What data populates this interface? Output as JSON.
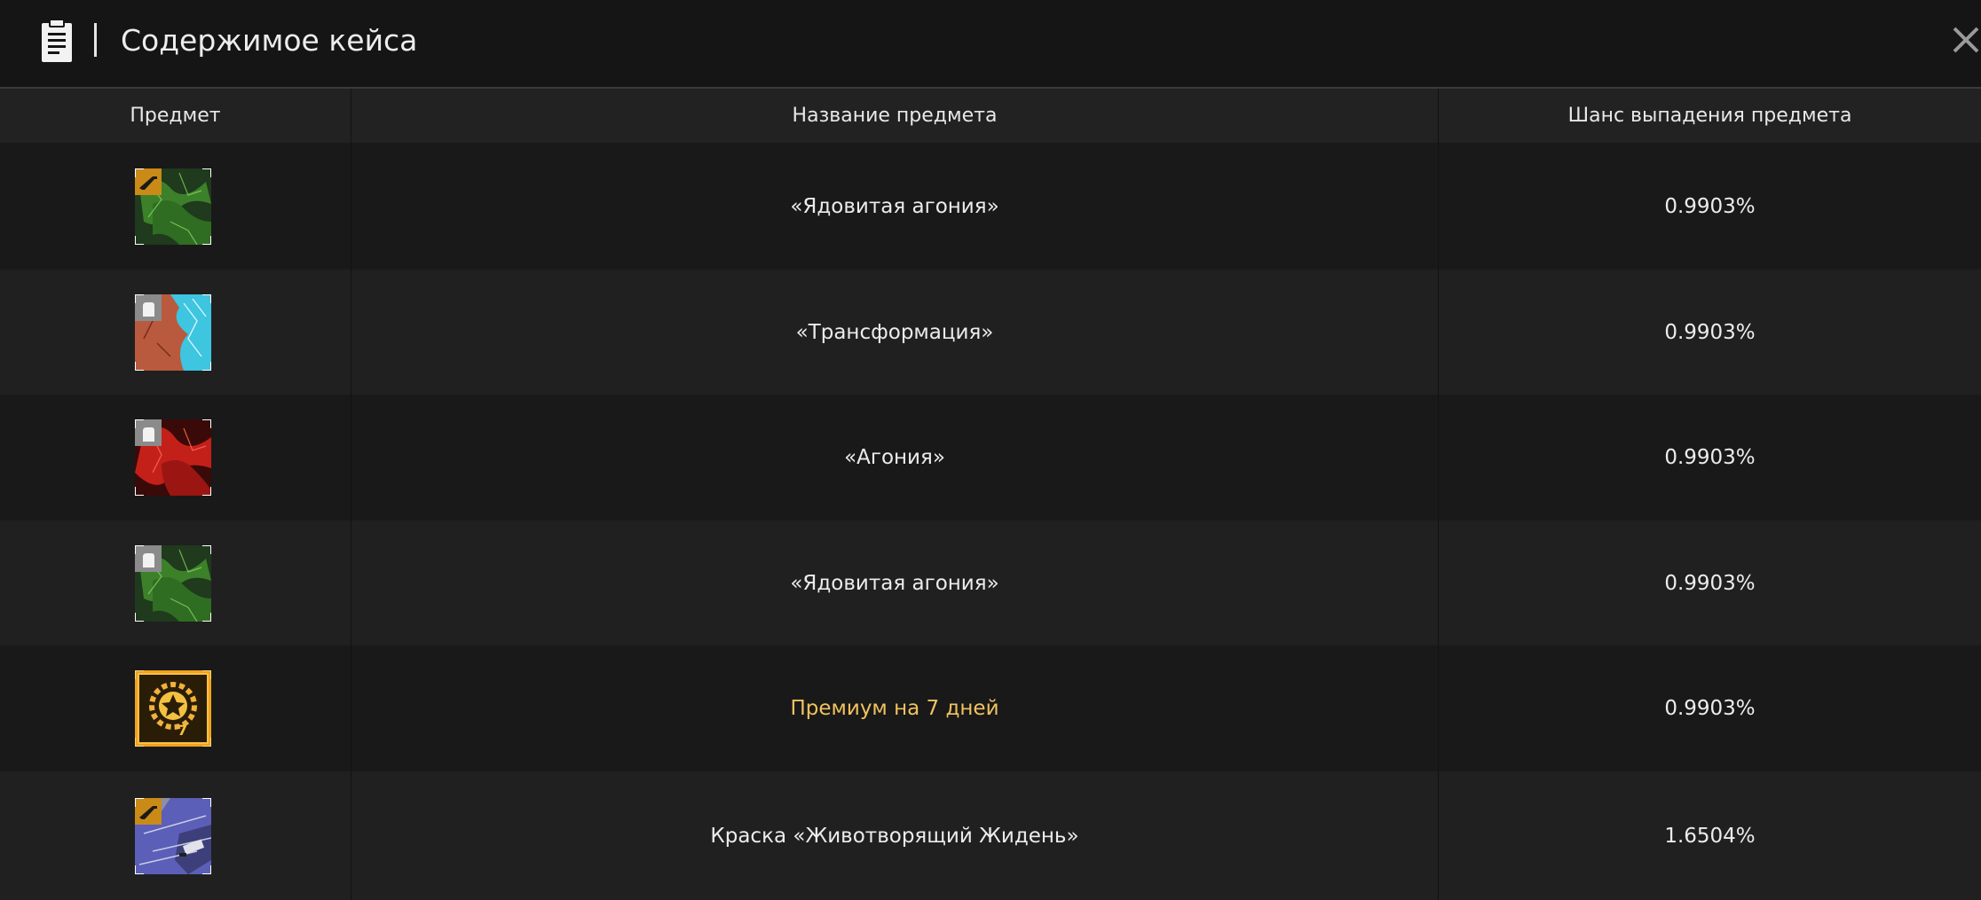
{
  "header": {
    "title": "Содержимое кейса",
    "icon": "clipboard-icon",
    "close_icon": "close-icon"
  },
  "table": {
    "columns": [
      "Предмет",
      "Название предмета",
      "Шанс выпадения предмета"
    ],
    "rows": [
      {
        "name": "«Ядовитая агония»",
        "chance": "0.9903%",
        "icon": "green-camo-skin-icon",
        "badge": "rifle-badge-icon"
      },
      {
        "name": "«Трансформация»",
        "chance": "0.9903%",
        "icon": "red-blue-camo-skin-icon",
        "badge": "glove-badge-icon"
      },
      {
        "name": "«Агония»",
        "chance": "0.9903%",
        "icon": "red-camo-skin-icon",
        "badge": "glove-badge-icon"
      },
      {
        "name": "«Ядовитая агония»",
        "chance": "0.9903%",
        "icon": "green-camo-skin-icon",
        "badge": "glove-badge-icon"
      },
      {
        "name": "Премиум на 7 дней",
        "chance": "0.9903%",
        "icon": "premium-star-icon",
        "badge": "",
        "premium_label": "7"
      },
      {
        "name": "Краска «Животворящий Жидень»",
        "chance": "1.6504%",
        "icon": "purple-paint-skin-icon",
        "badge": "rifle-badge-icon"
      }
    ]
  },
  "colors": {
    "header_bg": "#151515",
    "row_dark": "#191919",
    "row_light": "#202020",
    "premium_text": "#f1c25f",
    "badge_orange": "#c98a17"
  }
}
